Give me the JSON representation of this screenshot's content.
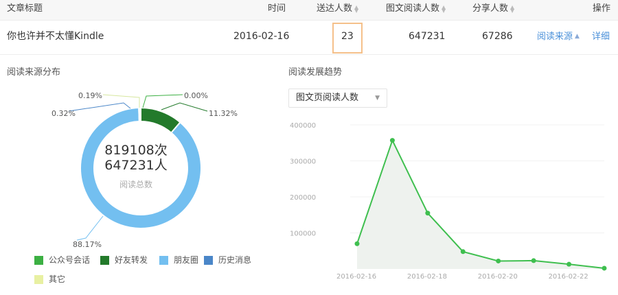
{
  "table": {
    "headers": {
      "title": "文章标题",
      "time": "时间",
      "delivered": "送达人数",
      "readers": "图文阅读人数",
      "sharers": "分享人数",
      "actions": "操作"
    },
    "row": {
      "title": "你也许并不太懂Kindle",
      "time": "2016-02-16",
      "delivered": "23",
      "readers": "647231",
      "sharers": "67286",
      "source_link": "阅读来源",
      "detail_link": "详细"
    }
  },
  "pie_section": {
    "title": "阅读来源分布",
    "total_reads": "819108次",
    "total_people": "647231人",
    "total_label": "阅读总数"
  },
  "line_section": {
    "title": "阅读发展趋势",
    "dropdown_value": "图文页阅读人数"
  },
  "chart_data": [
    {
      "type": "pie",
      "style": "donut",
      "slices": [
        {
          "name": "公众号会话",
          "value": 0.0,
          "label": "0.00%",
          "color": "#3cb043"
        },
        {
          "name": "好友转发",
          "value": 11.32,
          "label": "11.32%",
          "color": "#237a2b"
        },
        {
          "name": "朋友圈",
          "value": 88.17,
          "label": "88.17%",
          "color": "#73bff0"
        },
        {
          "name": "历史消息",
          "value": 0.32,
          "label": "0.32%",
          "color": "#4a86c8"
        },
        {
          "name": "其它",
          "value": 0.19,
          "label": "0.19%",
          "color": "#e8f0a2"
        }
      ],
      "legend": [
        "公众号会话",
        "好友转发",
        "朋友圈",
        "历史消息",
        "其它"
      ],
      "legend_position": "bottom"
    },
    {
      "type": "line",
      "series": [
        {
          "color": "#3fbf4f",
          "points": [
            {
              "x": "2016-02-16",
              "y": 70000
            },
            {
              "x": "2016-02-17",
              "y": 357000
            },
            {
              "x": "2016-02-18",
              "y": 155000
            },
            {
              "x": "2016-02-19",
              "y": 48000
            },
            {
              "x": "2016-02-20",
              "y": 22000
            },
            {
              "x": "2016-02-21",
              "y": 23000
            },
            {
              "x": "2016-02-22",
              "y": 13000
            },
            {
              "x": "2016-02-23",
              "y": 2000
            }
          ]
        }
      ],
      "x_tick_labels": [
        "2016-02-16",
        "2016-02-18",
        "2016-02-20",
        "2016-02-22"
      ],
      "y_tick_labels": [
        "100000",
        "200000",
        "300000",
        "400000"
      ],
      "ylim": [
        0,
        400000
      ],
      "grid": true
    }
  ]
}
